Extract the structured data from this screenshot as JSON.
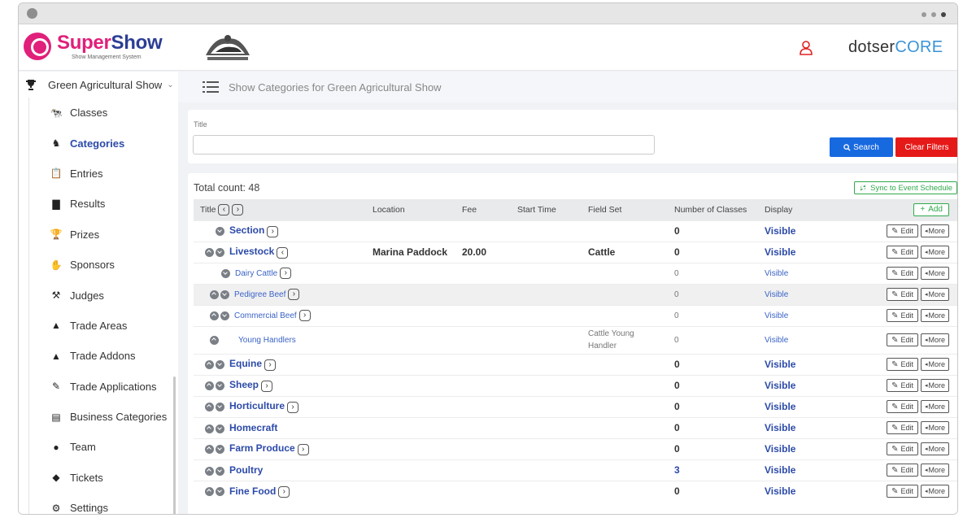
{
  "app": {
    "logo_name_a": "Super",
    "logo_name_b": "Show",
    "logo_sub": "Show Management System",
    "brand_a": "dotser",
    "brand_b": "CORE",
    "accent": "#e0207a",
    "primary": "#2c4aa8"
  },
  "sidebar": {
    "show_name": "Green Agricultural Show",
    "items": [
      {
        "label": "Classes",
        "icon": "classes-icon"
      },
      {
        "label": "Categories",
        "icon": "categories-icon"
      },
      {
        "label": "Entries",
        "icon": "entries-icon"
      },
      {
        "label": "Results",
        "icon": "results-icon"
      },
      {
        "label": "Prizes",
        "icon": "trophy-icon"
      },
      {
        "label": "Sponsors",
        "icon": "sponsors-icon"
      },
      {
        "label": "Judges",
        "icon": "gavel-icon"
      },
      {
        "label": "Trade Areas",
        "icon": "tent-icon"
      },
      {
        "label": "Trade Addons",
        "icon": "tent-plus-icon"
      },
      {
        "label": "Trade Applications",
        "icon": "edit-doc-icon"
      },
      {
        "label": "Business Categories",
        "icon": "business-icon"
      },
      {
        "label": "Team",
        "icon": "team-icon"
      },
      {
        "label": "Tickets",
        "icon": "ticket-icon"
      },
      {
        "label": "Settings",
        "icon": "settings-icon"
      }
    ]
  },
  "header": {
    "page_title": "Show Categories for Green Agricultural Show"
  },
  "filters": {
    "title_label": "Title",
    "title_value": "",
    "search_label": "Search",
    "clear_label": "Clear Filters"
  },
  "table": {
    "total_count": "Total count: 48",
    "sync_label": "Sync to Event Schedule",
    "add_label": "Add",
    "edit_label": "Edit",
    "more_label": "More",
    "columns": [
      "Title",
      "Location",
      "Fee",
      "Start Time",
      "Field Set",
      "Number of Classes",
      "Display"
    ],
    "rows": [
      {
        "title": "Section",
        "level": "main",
        "up": false,
        "down": true,
        "nav": "right",
        "location": "",
        "fee": "",
        "start": "",
        "field_set": "",
        "classes": "0",
        "display": "Visible",
        "shaded": false
      },
      {
        "title": "Livestock",
        "level": "main",
        "up": true,
        "down": true,
        "nav": "left",
        "location": "Marina Paddock",
        "fee": "20.00",
        "start": "",
        "field_set": "Cattle",
        "classes": "0",
        "display": "Visible",
        "shaded": false
      },
      {
        "title": "Dairy Cattle",
        "level": "sub",
        "up": false,
        "down": true,
        "nav": "right",
        "location": "",
        "fee": "",
        "start": "",
        "field_set": "",
        "classes": "0",
        "display": "Visible",
        "shaded": false
      },
      {
        "title": "Pedigree Beef",
        "level": "sub",
        "up": true,
        "down": true,
        "nav": "right",
        "location": "",
        "fee": "",
        "start": "",
        "field_set": "",
        "classes": "0",
        "display": "Visible",
        "shaded": true
      },
      {
        "title": "Commercial Beef",
        "level": "sub",
        "up": true,
        "down": true,
        "nav": "right",
        "location": "",
        "fee": "",
        "start": "",
        "field_set": "",
        "classes": "0",
        "display": "Visible",
        "shaded": false
      },
      {
        "title": "Young Handlers",
        "level": "sub",
        "up": true,
        "down": false,
        "nav": "",
        "location": "",
        "fee": "",
        "start": "",
        "field_set": "Cattle Young Handler",
        "classes": "0",
        "display": "Visible",
        "shaded": false
      },
      {
        "title": "Equine",
        "level": "main",
        "up": true,
        "down": true,
        "nav": "right",
        "location": "",
        "fee": "",
        "start": "",
        "field_set": "",
        "classes": "0",
        "display": "Visible",
        "shaded": false
      },
      {
        "title": "Sheep",
        "level": "main",
        "up": true,
        "down": true,
        "nav": "right",
        "location": "",
        "fee": "",
        "start": "",
        "field_set": "",
        "classes": "0",
        "display": "Visible",
        "shaded": false
      },
      {
        "title": "Horticulture",
        "level": "main",
        "up": true,
        "down": true,
        "nav": "right",
        "location": "",
        "fee": "",
        "start": "",
        "field_set": "",
        "classes": "0",
        "display": "Visible",
        "shaded": false
      },
      {
        "title": "Homecraft",
        "level": "main",
        "up": true,
        "down": true,
        "nav": "",
        "location": "",
        "fee": "",
        "start": "",
        "field_set": "",
        "classes": "0",
        "display": "Visible",
        "shaded": false
      },
      {
        "title": "Farm Produce",
        "level": "main",
        "up": true,
        "down": true,
        "nav": "right",
        "location": "",
        "fee": "",
        "start": "",
        "field_set": "",
        "classes": "0",
        "display": "Visible",
        "shaded": false
      },
      {
        "title": "Poultry",
        "level": "main",
        "up": true,
        "down": true,
        "nav": "",
        "location": "",
        "fee": "",
        "start": "",
        "field_set": "",
        "classes": "3",
        "display": "Visible",
        "shaded": false
      },
      {
        "title": "Fine Food",
        "level": "main",
        "up": true,
        "down": true,
        "nav": "right",
        "location": "",
        "fee": "",
        "start": "",
        "field_set": "",
        "classes": "0",
        "display": "Visible",
        "shaded": false
      }
    ]
  }
}
